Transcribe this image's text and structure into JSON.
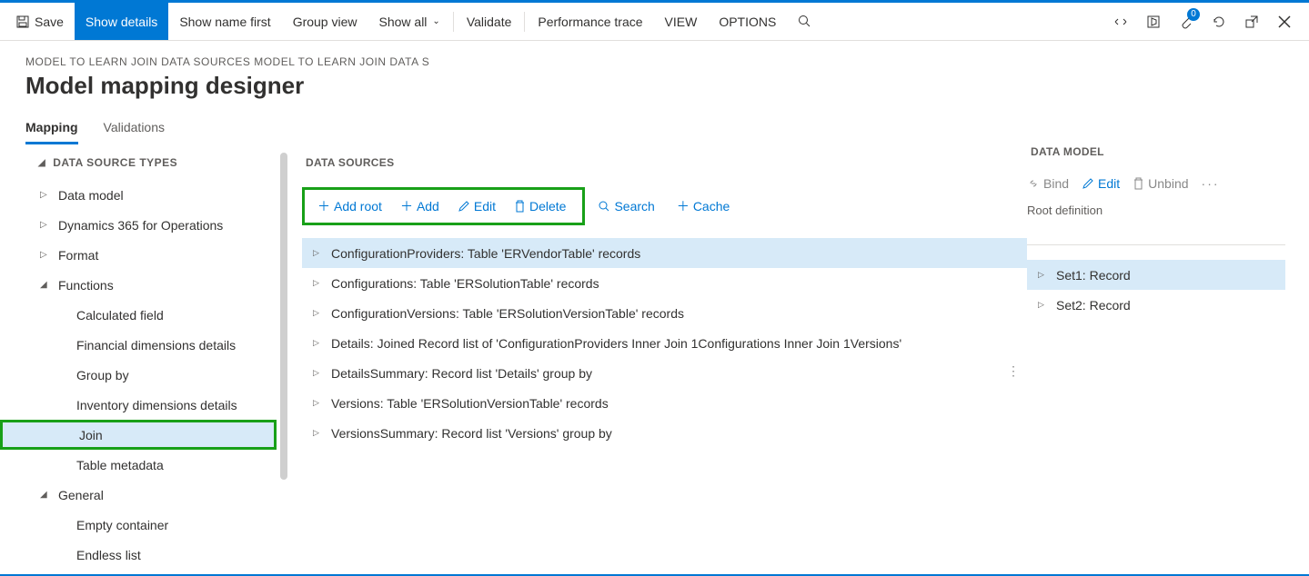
{
  "toolbar": {
    "save": "Save",
    "show_details": "Show details",
    "show_name_first": "Show name first",
    "group_view": "Group view",
    "show_all": "Show all",
    "validate": "Validate",
    "perf_trace": "Performance trace",
    "view": "VIEW",
    "options": "OPTIONS",
    "attach_badge": "0"
  },
  "breadcrumb": "MODEL TO LEARN JOIN DATA SOURCES MODEL TO LEARN JOIN DATA S",
  "page_title": "Model mapping designer",
  "tabs": {
    "mapping": "Mapping",
    "validations": "Validations"
  },
  "left": {
    "header": "DATA SOURCE TYPES",
    "items": [
      {
        "label": "Data model",
        "level": 0,
        "arrow": "▷"
      },
      {
        "label": "Dynamics 365 for Operations",
        "level": 0,
        "arrow": "▷"
      },
      {
        "label": "Format",
        "level": 0,
        "arrow": "▷"
      },
      {
        "label": "Functions",
        "level": 0,
        "arrow": "◢",
        "expanded": true
      },
      {
        "label": "Calculated field",
        "level": 1
      },
      {
        "label": "Financial dimensions details",
        "level": 1
      },
      {
        "label": "Group by",
        "level": 1
      },
      {
        "label": "Inventory dimensions details",
        "level": 1
      },
      {
        "label": "Join",
        "level": 1,
        "selected": true,
        "green": true
      },
      {
        "label": "Table metadata",
        "level": 1
      },
      {
        "label": "General",
        "level": 0,
        "arrow": "◢",
        "expanded": true
      },
      {
        "label": "Empty container",
        "level": 1
      },
      {
        "label": "Endless list",
        "level": 1
      }
    ]
  },
  "mid": {
    "header": "DATA SOURCES",
    "actions": {
      "add_root": "Add root",
      "add": "Add",
      "edit": "Edit",
      "delete": "Delete",
      "search": "Search",
      "cache": "Cache"
    },
    "items": [
      {
        "label": "ConfigurationProviders: Table 'ERVendorTable' records",
        "selected": true
      },
      {
        "label": "Configurations: Table 'ERSolutionTable' records"
      },
      {
        "label": "ConfigurationVersions: Table 'ERSolutionVersionTable' records"
      },
      {
        "label": "Details: Joined Record list of 'ConfigurationProviders Inner Join 1Configurations Inner Join 1Versions'"
      },
      {
        "label": "DetailsSummary: Record list 'Details' group by"
      },
      {
        "label": "Versions: Table 'ERSolutionVersionTable' records"
      },
      {
        "label": "VersionsSummary: Record list 'Versions' group by"
      }
    ]
  },
  "right": {
    "header": "DATA MODEL",
    "actions": {
      "bind": "Bind",
      "edit": "Edit",
      "unbind": "Unbind"
    },
    "root_def": "Root definition",
    "items": [
      {
        "label": "Set1: Record",
        "selected": true
      },
      {
        "label": "Set2: Record"
      }
    ]
  }
}
